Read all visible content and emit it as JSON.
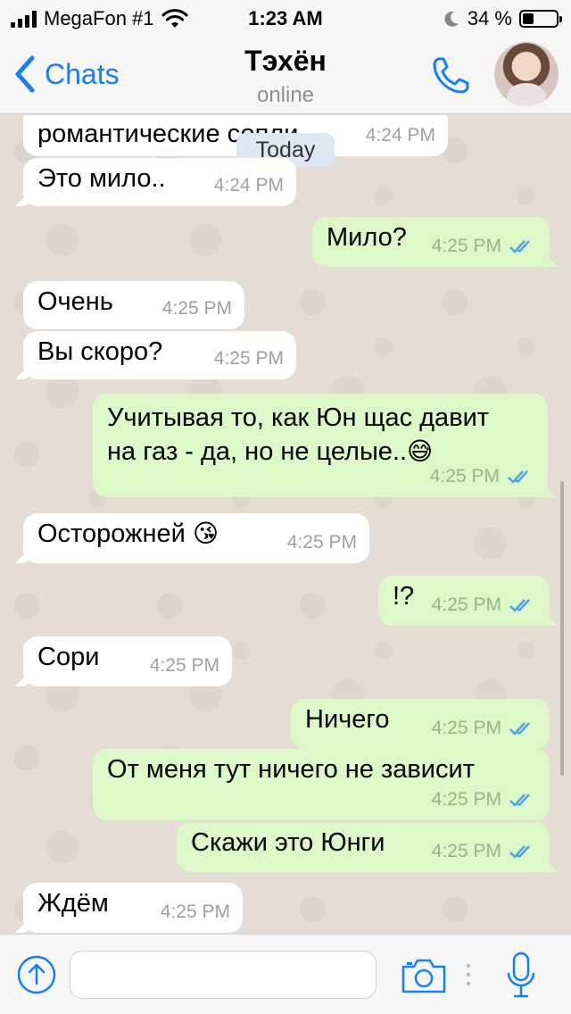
{
  "status_bar": {
    "carrier": "MegaFon #1",
    "time": "1:23 AM",
    "battery_text": "34 %",
    "battery_level": 0.34
  },
  "header": {
    "back_label": "Chats",
    "contact_name": "Тэхён",
    "contact_status": "online"
  },
  "chat": {
    "date_badge": "Today",
    "messages": [
      {
        "dir": "in",
        "text": "романтические сопли",
        "time": "4:24 PM"
      },
      {
        "dir": "in",
        "text": "Это мило..",
        "time": "4:24 PM"
      },
      {
        "dir": "out",
        "text": "Мило?",
        "time": "4:25 PM"
      },
      {
        "dir": "in",
        "text": "Очень",
        "time": "4:25 PM"
      },
      {
        "dir": "in",
        "text": "Вы скоро?",
        "time": "4:25 PM"
      },
      {
        "dir": "out",
        "text_line1": "Учитывая то, как Юн щас давит",
        "text_line2": "на газ - да, но не целые..",
        "emoji": "😅",
        "time": "4:25 PM"
      },
      {
        "dir": "in",
        "text": "Осторожней",
        "emoji": "😘",
        "time": "4:25 PM"
      },
      {
        "dir": "out",
        "text": "!?",
        "time": "4:25 PM"
      },
      {
        "dir": "in",
        "text": "Сори",
        "time": "4:25 PM"
      },
      {
        "dir": "out",
        "text": "Ничего",
        "time": "4:25 PM"
      },
      {
        "dir": "out",
        "text": "От меня тут ничего не зависит",
        "time": "4:25 PM"
      },
      {
        "dir": "out",
        "text": "Скажи это Юнги",
        "time": "4:25 PM"
      },
      {
        "dir": "in",
        "text": "Ждём",
        "time": "4:25 PM"
      }
    ]
  },
  "input_bar": {
    "message_value": "",
    "message_placeholder": ""
  },
  "colors": {
    "accent": "#147efb",
    "incoming_bubble": "#ffffff",
    "outgoing_bubble": "#dcf8c6",
    "read_ticks": "#4fa3e6"
  },
  "icons": {
    "status_bar": [
      "signal-icon",
      "wifi-icon",
      "moon-icon",
      "battery-icon"
    ],
    "header": [
      "back-chevron-icon",
      "phone-icon"
    ],
    "input_bar": [
      "plus-icon",
      "camera-icon",
      "microphone-icon"
    ]
  }
}
